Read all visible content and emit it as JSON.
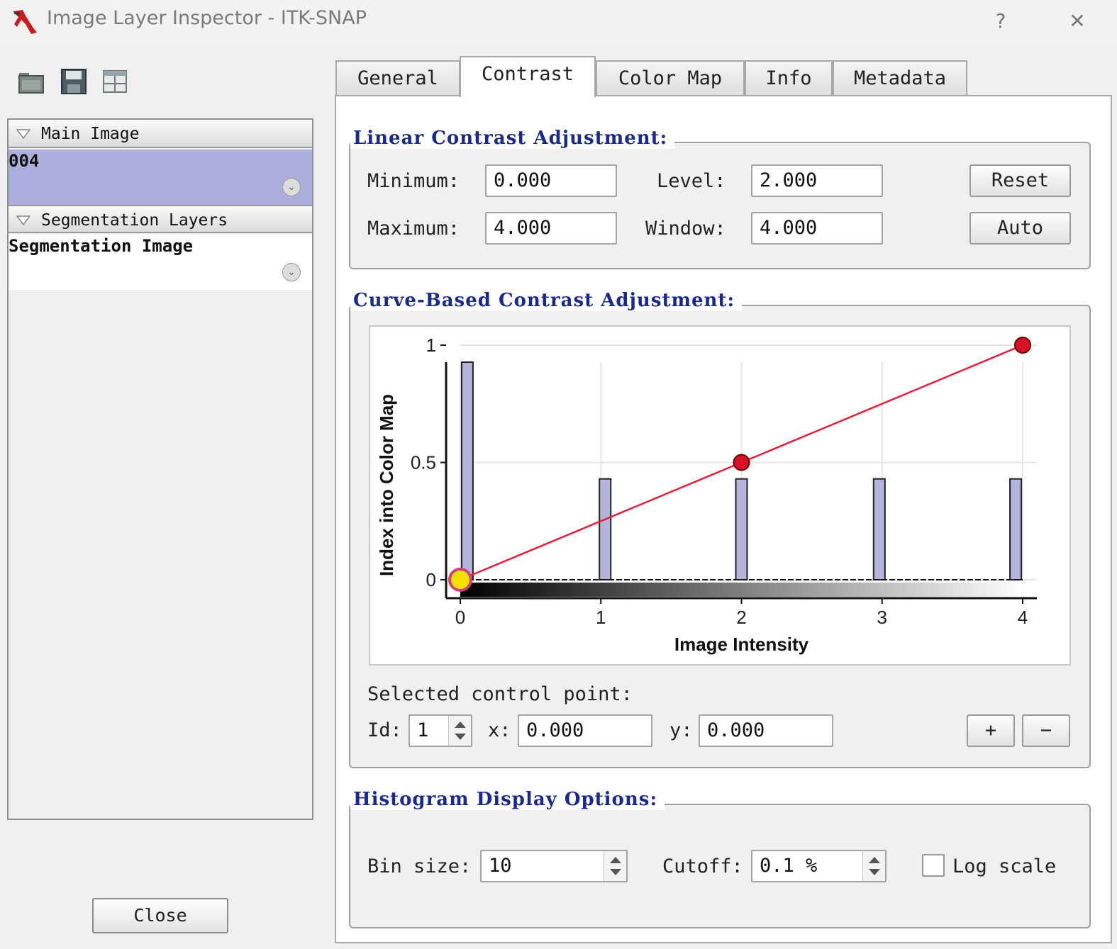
{
  "window": {
    "title": "Image Layer Inspector - ITK-SNAP",
    "help_glyph": "?",
    "close_glyph": "✕"
  },
  "toolbar": {
    "icons": [
      "open-folder-icon",
      "save-disk-icon",
      "layout-grid-icon"
    ]
  },
  "layers": {
    "main_group_label": "Main Image",
    "main_layer_name": "004",
    "segmentation_group_label": "Segmentation Layers",
    "segmentation_layer_name": "Segmentation Image",
    "menu_glyph": "⌄"
  },
  "close_button": "Close",
  "tabs": [
    {
      "label": "General",
      "active": false
    },
    {
      "label": "Contrast",
      "active": true
    },
    {
      "label": "Color Map",
      "active": false
    },
    {
      "label": "Info",
      "active": false
    },
    {
      "label": "Metadata",
      "active": false
    }
  ],
  "linear": {
    "title": "Linear Contrast Adjustment:",
    "minimum_label": "Minimum:",
    "minimum": "0.000",
    "maximum_label": "Maximum:",
    "maximum": "4.000",
    "level_label": "Level:",
    "level": "2.000",
    "window_label": "Window:",
    "window": "4.000",
    "reset": "Reset",
    "auto": "Auto"
  },
  "curve": {
    "title": "Curve-Based Contrast Adjustment:",
    "selected_label": "Selected control point:",
    "id_label": "Id:",
    "id_value": "1",
    "x_label": "x:",
    "x_value": "0.000",
    "y_label": "y:",
    "y_value": "0.000",
    "add": "+",
    "remove": "−"
  },
  "histogram": {
    "title": "Histogram Display Options:",
    "bin_label": "Bin size:",
    "bin_value": "10",
    "cutoff_label": "Cutoff:",
    "cutoff_value": "0.1 %",
    "log_label": "Log scale",
    "log_checked": false
  },
  "chart_data": {
    "type": "line",
    "xlabel": "Image Intensity",
    "ylabel": "Index into Color Map",
    "xlim": [
      0,
      4
    ],
    "ylim": [
      0,
      1
    ],
    "x_ticks": [
      "0",
      "1",
      "2",
      "3",
      "4"
    ],
    "y_ticks": [
      "0",
      "0.5",
      "1"
    ],
    "grid": true,
    "histogram_bins": [
      {
        "x": 0.05,
        "value": 1.0
      },
      {
        "x": 1.03,
        "value": 0.43
      },
      {
        "x": 2.0,
        "value": 0.43
      },
      {
        "x": 2.98,
        "value": 0.43
      },
      {
        "x": 3.95,
        "value": 0.43
      }
    ],
    "series": [
      {
        "x": [
          0,
          2,
          4
        ],
        "y": [
          0,
          0.5,
          1
        ]
      }
    ],
    "control_points": [
      {
        "x": 0,
        "y": 0,
        "selected": true
      },
      {
        "x": 2,
        "y": 0.5,
        "selected": false
      },
      {
        "x": 4,
        "y": 1,
        "selected": false
      }
    ],
    "colors": {
      "curve": "#e0203a",
      "histogram": "#b4b4dc",
      "selected_point": "#f4e000",
      "control_point": "#d8102a"
    }
  }
}
